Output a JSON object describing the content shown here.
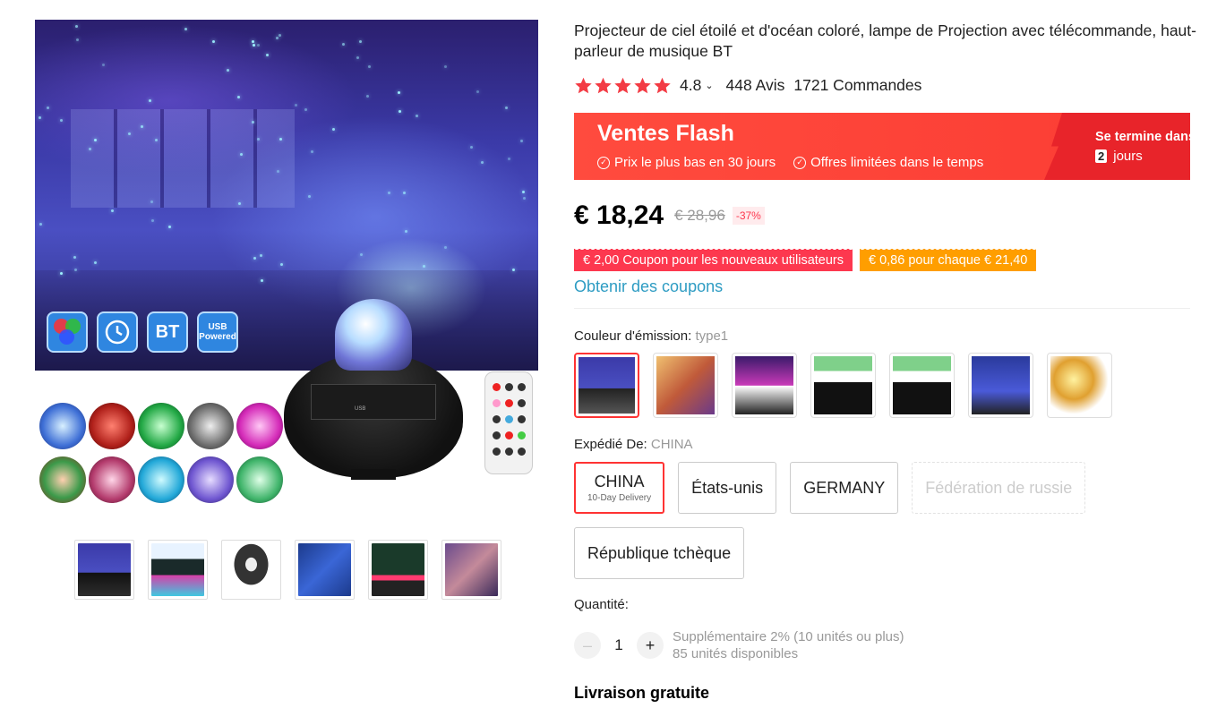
{
  "product": {
    "title": "Projecteur de ciel étoilé et d'océan coloré, lampe de Projection avec télécommande, haut-parleur de musique BT"
  },
  "rating": {
    "stars": 4.8,
    "value": "4.8",
    "reviews": "448 Avis",
    "orders": "1721 Commandes"
  },
  "flash": {
    "title": "Ventes Flash",
    "point1": "Prix le plus bas en 30 jours",
    "point2": "Offres limitées dans le temps",
    "ends": "Se termine dans",
    "days_num": "2",
    "days_label": "jours"
  },
  "price": {
    "current": "€ 18,24",
    "original": "€ 28,96",
    "discount": "-37%"
  },
  "coupons": {
    "new_users": "€ 2,00 Coupon pour les nouveaux utilisateurs",
    "per_amount": "€ 0,86 pour chaque € 21,40",
    "get_link": "Obtenir des coupons"
  },
  "emission": {
    "label": "Couleur d'émission:",
    "value": "type1"
  },
  "shipping": {
    "label": "Expédié De:",
    "value": "CHINA",
    "options": [
      {
        "label": "CHINA",
        "sub": "10-Day Delivery"
      },
      {
        "label": "États-unis"
      },
      {
        "label": "GERMANY"
      },
      {
        "label": "Fédération de russie"
      },
      {
        "label": "République tchèque"
      }
    ]
  },
  "quantity": {
    "label": "Quantité:",
    "value": "1",
    "minus": "–",
    "plus": "+",
    "extra": "Supplémentaire 2% (10 unités ou plus)",
    "available": "85 unités disponibles"
  },
  "delivery": {
    "free": "Livraison gratuite"
  },
  "gallery": {
    "badge_bt": "BT",
    "badge_usb": "USB Powered"
  },
  "colors": {
    "accent": "#ff4b3e",
    "price_red": "#fd384f",
    "link": "#2e9cc3",
    "star": "#f33b44",
    "coupon_orange": "#ff9e00"
  }
}
